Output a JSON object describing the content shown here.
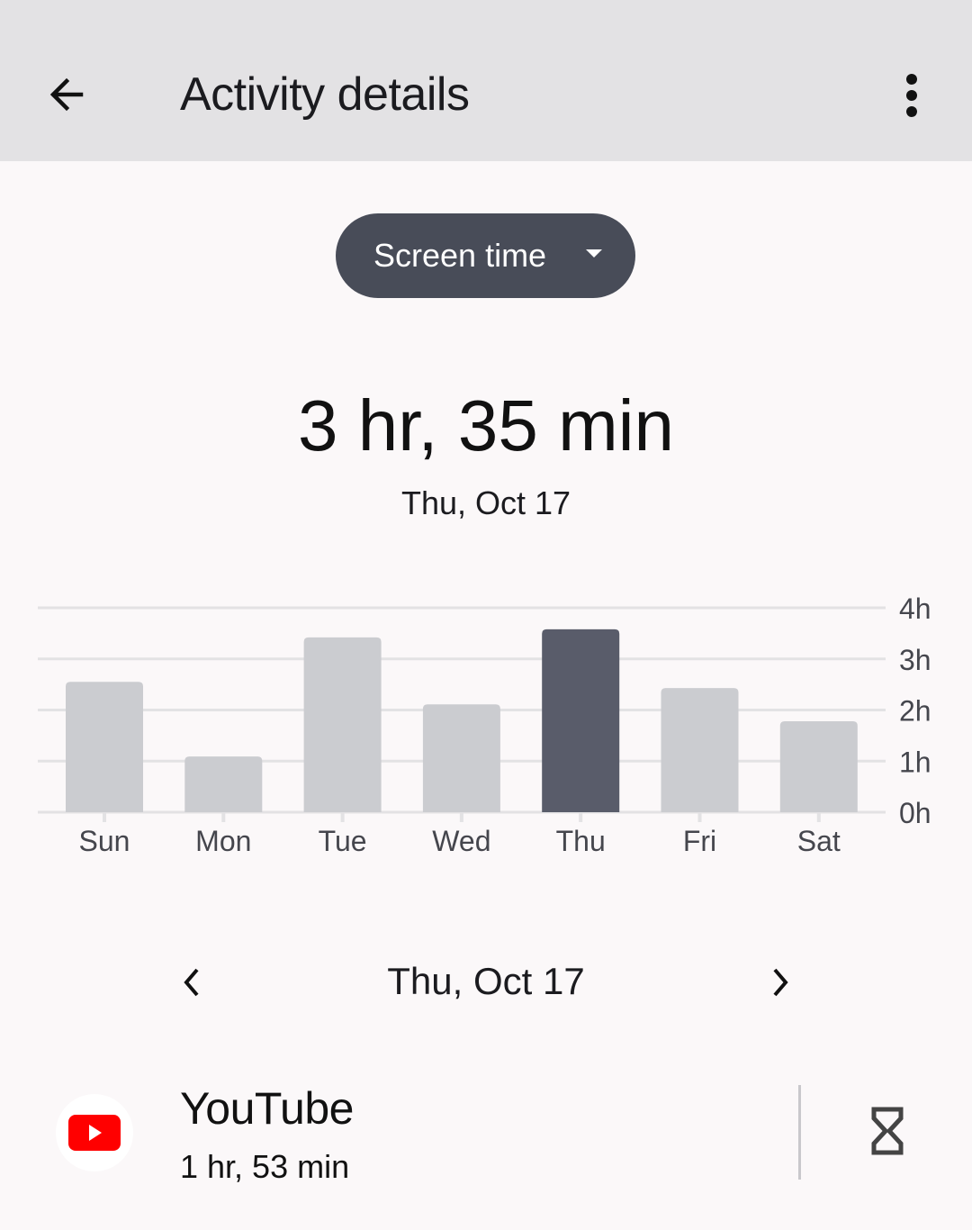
{
  "appbar": {
    "title": "Activity details",
    "back_icon": "arrow-back-icon",
    "more_icon": "more-vert-icon"
  },
  "metric_selector": {
    "selected": "Screen time",
    "icon": "dropdown-caret-icon"
  },
  "summary": {
    "total": "3 hr, 35 min",
    "date": "Thu, Oct 17"
  },
  "colors": {
    "appbar_bg": "#e3e2e4",
    "page_bg": "#fbf8f9",
    "selector_bg": "#484c58",
    "bar_default": "#cbccd0",
    "bar_selected": "#595c6a",
    "gridline": "#e3e2e4",
    "axis_text": "#45464d",
    "youtube_red": "#ff0000"
  },
  "chart_data": {
    "type": "bar",
    "title": "",
    "xlabel": "",
    "ylabel": "",
    "categories": [
      "Sun",
      "Mon",
      "Tue",
      "Wed",
      "Thu",
      "Fri",
      "Sat"
    ],
    "values": [
      2.55,
      1.09,
      3.42,
      2.11,
      3.58,
      2.43,
      1.78
    ],
    "unit": "hours",
    "selected_index": 4,
    "ylim": [
      0,
      4
    ],
    "yticks": [
      0,
      1,
      2,
      3,
      4
    ],
    "ytick_labels": [
      "0h",
      "1h",
      "2h",
      "3h",
      "4h"
    ],
    "y_axis_side": "right",
    "grid": true,
    "legend": "none"
  },
  "day_nav": {
    "date": "Thu, Oct 17",
    "prev_icon": "chevron-left-icon",
    "next_icon": "chevron-right-icon"
  },
  "apps": [
    {
      "name": "YouTube",
      "time": "1 hr, 53 min",
      "icon": "youtube-icon",
      "action_icon": "hourglass-timer-icon"
    }
  ]
}
